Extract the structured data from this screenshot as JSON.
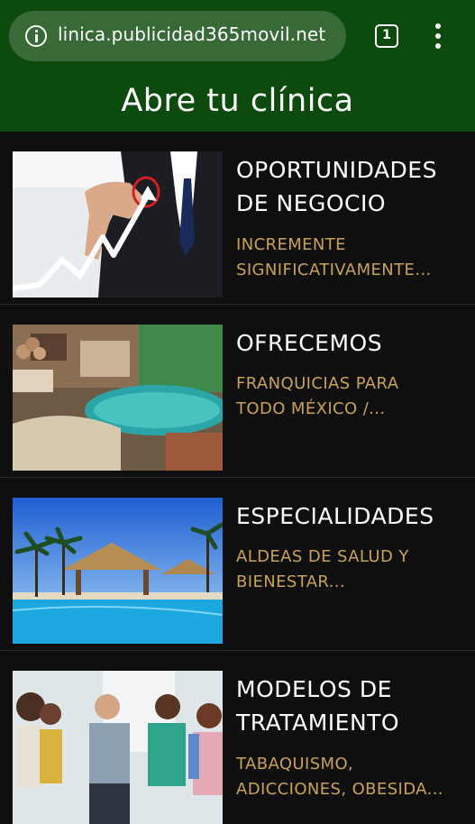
{
  "browser": {
    "url": "linica.publicidad365movil.net",
    "tab_count": "1"
  },
  "header": {
    "title": "Abre tu clínica"
  },
  "cards": [
    {
      "title_line1": "OPORTUNIDADES",
      "title_line2": "DE NEGOCIO",
      "desc_line1": "INCREMENTE",
      "desc_line2": "SIGNIFICATIVAMENTE..."
    },
    {
      "title_line1": "OFRECEMOS",
      "title_line2": "",
      "desc_line1": "FRANQUICIAS PARA",
      "desc_line2": "TODO MÉXICO /..."
    },
    {
      "title_line1": "ESPECIALIDADES",
      "title_line2": "",
      "desc_line1": "ALDEAS DE SALUD Y",
      "desc_line2": "BIENESTAR..."
    },
    {
      "title_line1": "MODELOS DE",
      "title_line2": "TRATAMIENTO",
      "desc_line1": "TABAQUISMO,",
      "desc_line2": "ADICCIONES, OBESIDA..."
    }
  ],
  "colors": {
    "header_bg": "#0d4a0d",
    "page_bg": "#0f0f0f",
    "desc_text": "#c9a25a"
  }
}
